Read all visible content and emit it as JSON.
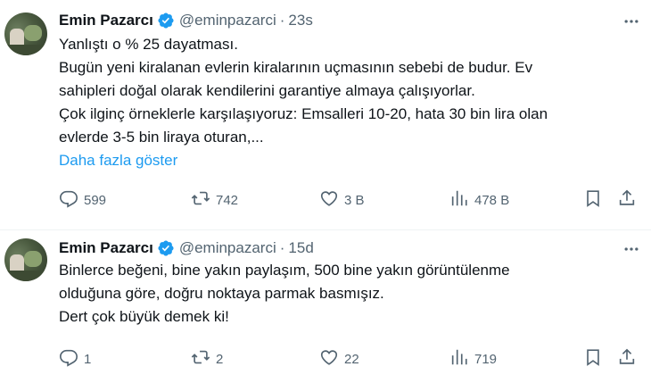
{
  "tweets": [
    {
      "author_name": "Emin Pazarcı",
      "handle": "@eminpazarci",
      "separator": "·",
      "time": "23s",
      "lines": [
        "Yanlıştı o % 25 dayatması.",
        "Bugün yeni kiralanan evlerin kiralarının uçmasının sebebi de budur. Ev",
        "sahipleri doğal olarak kendilerini garantiye almaya çalışıyorlar.",
        "Çok ilginç örneklerle karşılaşıyoruz: Emsalleri 10-20, hata 30 bin lira olan",
        "evlerde 3-5 bin liraya oturan,..."
      ],
      "show_more": "Daha fazla göster",
      "replies": "599",
      "retweets": "742",
      "likes": "3 B",
      "views": "478 B"
    },
    {
      "author_name": "Emin Pazarcı",
      "handle": "@eminpazarci",
      "separator": "·",
      "time": "15d",
      "lines": [
        "Binlerce beğeni, bine yakın paylaşım, 500 bine yakın görüntülenme",
        "olduğuna göre, doğru noktaya parmak basmışız.",
        "Dert çok büyük demek ki!"
      ],
      "replies": "1",
      "retweets": "2",
      "likes": "22",
      "views": "719"
    }
  ],
  "colors": {
    "text": "#0f1419",
    "secondary": "#536471",
    "link": "#1d9bf0",
    "verified": "#1d9bf0"
  },
  "icons": [
    "verified-badge-icon",
    "more-icon",
    "reply-icon",
    "retweet-icon",
    "like-icon",
    "views-icon",
    "bookmark-icon",
    "share-icon"
  ]
}
